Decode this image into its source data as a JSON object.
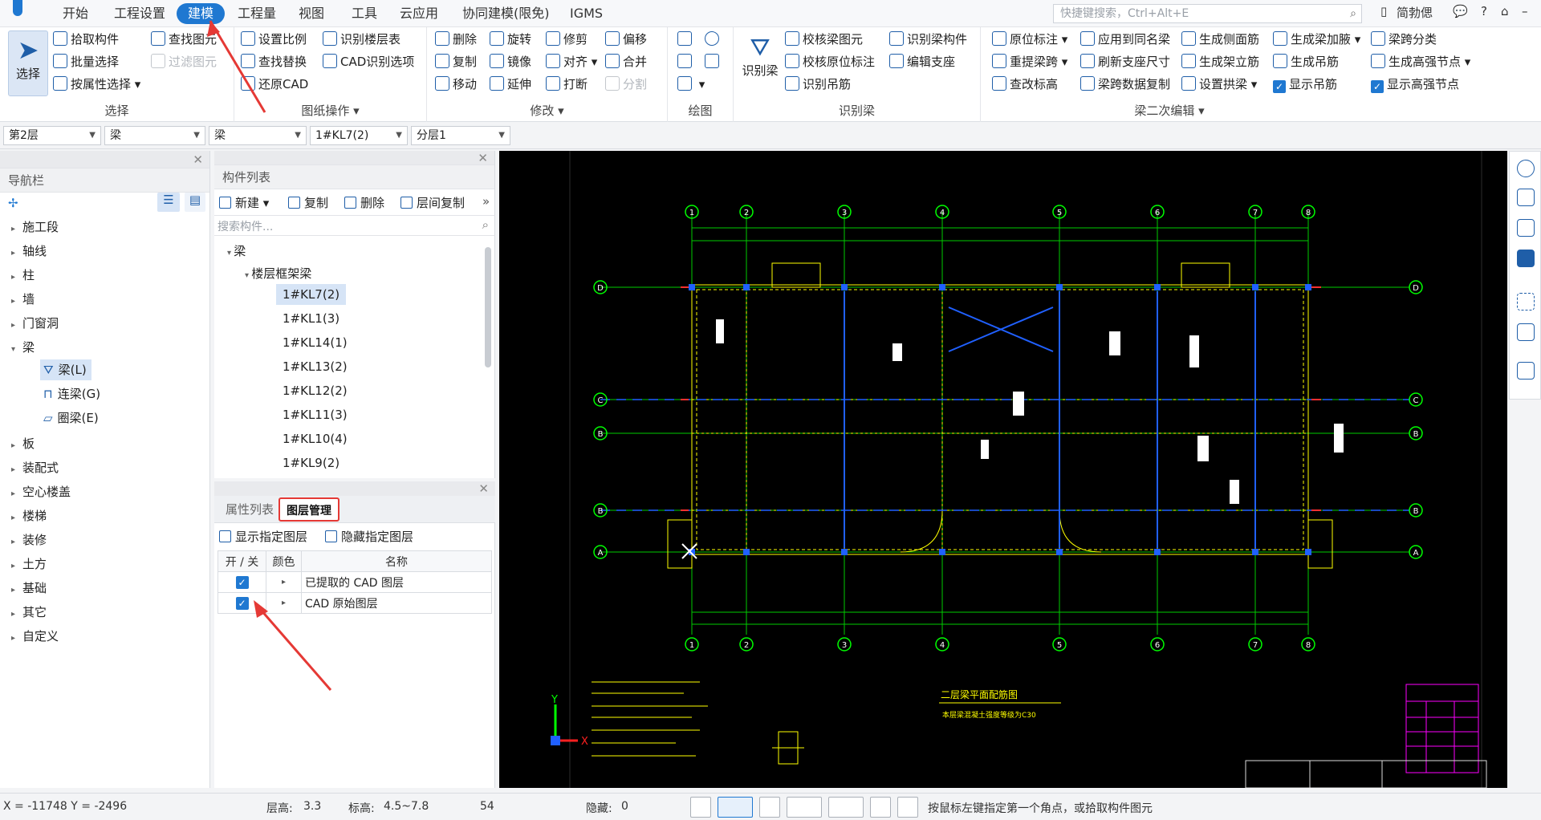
{
  "menubar": {
    "items": [
      "开始",
      "工程设置",
      "建模",
      "工程量",
      "视图",
      "工具",
      "云应用",
      "协同建模(限免)",
      "IGMS"
    ],
    "active_index": 2,
    "search_placeholder": "快捷键搜索，Ctrl+Alt+E",
    "right": {
      "user": "简勃偲",
      "help": "?",
      "chat_icon": "chat-icon",
      "share_icon": "shirt-icon"
    }
  },
  "ribbon": {
    "select_group": {
      "big_button": "选择",
      "items": [
        "拾取构件",
        "批量选择",
        "按属性选择",
        "查找图元",
        "过滤图元"
      ],
      "label": "选择"
    },
    "drawing_ops": {
      "items": [
        "设置比例",
        "识别楼层表",
        "查找替换",
        "CAD识别选项",
        "还原CAD"
      ],
      "label": "图纸操作"
    },
    "modify": {
      "items": [
        "删除",
        "旋转",
        "修剪",
        "偏移",
        "复制",
        "镜像",
        "对齐",
        "合并",
        "移动",
        "延伸",
        "打断",
        "分割"
      ],
      "label": "修改"
    },
    "draw": {
      "label": "绘图"
    },
    "recognize_beam": {
      "big_button": "识别梁",
      "items": [
        "校核梁图元",
        "识别梁构件",
        "校核原位标注",
        "编辑支座",
        "识别吊筋"
      ],
      "label": "识别梁"
    },
    "secondary_edit": {
      "items": [
        "原位标注",
        "应用到同名梁",
        "生成侧面筋",
        "生成梁加腋",
        "梁跨分类",
        "重提梁跨",
        "刷新支座尺寸",
        "生成架立筋",
        "生成吊筋",
        "生成高强节点",
        "查改标高",
        "梁跨数据复制",
        "设置拱梁",
        "显示吊筋",
        "显示高强节点"
      ],
      "label": "梁二次编辑"
    }
  },
  "selectors": [
    "第2层",
    "梁",
    "梁",
    "1#KL7(2)",
    "分层1"
  ],
  "nav": {
    "title": "导航栏",
    "tree": [
      "施工段",
      "轴线",
      "柱",
      "墙",
      "门窗洞",
      "梁",
      "板",
      "装配式",
      "空心楼盖",
      "楼梯",
      "装修",
      "土方",
      "基础",
      "其它",
      "自定义"
    ],
    "beam_children": [
      "梁(L)",
      "连梁(G)",
      "圈梁(E)"
    ]
  },
  "component_list": {
    "title": "构件列表",
    "toolbar": [
      "新建",
      "复制",
      "删除",
      "层间复制"
    ],
    "search_placeholder": "搜索构件...",
    "root": "梁",
    "category": "楼层框架梁",
    "items": [
      "1#KL7(2)",
      "1#KL1(3)",
      "1#KL14(1)",
      "1#KL13(2)",
      "1#KL12(2)",
      "1#KL11(3)",
      "1#KL10(4)",
      "1#KL9(2)"
    ],
    "selected_index": 0
  },
  "layer_panel": {
    "tabs": [
      "属性列表",
      "图层管理"
    ],
    "active_tab": 1,
    "actions": [
      "显示指定图层",
      "隐藏指定图层"
    ],
    "columns": [
      "开 / 关",
      "颜色",
      "名称"
    ],
    "rows": [
      {
        "on": true,
        "name": "已提取的 CAD 图层"
      },
      {
        "on": true,
        "name": "CAD 原始图层"
      }
    ]
  },
  "canvas": {
    "axis_labels_top": [
      "1",
      "2",
      "3",
      "4",
      "5",
      "6",
      "7",
      "8"
    ],
    "axis_labels_side": [
      "D",
      "C",
      "B",
      "B",
      "A"
    ],
    "title_block_caption": "二层梁平面配筋图",
    "title_block_sub": "本层梁混凝土强度等级为C30",
    "axis_x": "X",
    "axis_y": "Y"
  },
  "statusbar": {
    "coords": "X = -11748 Y = -2496",
    "floor_height_label": "层高:",
    "floor_height": "3.3",
    "elevation_label": "标高:",
    "elevation": "4.5~7.8",
    "count": "54",
    "hidden_label": "隐藏:",
    "hidden": "0",
    "hint": "按鼠标左键指定第一个角点，或拾取构件图元"
  },
  "colors": {
    "accent": "#1f78d1",
    "highlight": "#e53935",
    "cad_bg": "#000000",
    "grid_green": "#00ff00",
    "cad_yellow": "#ffff00",
    "cad_blue": "#2060ff",
    "cad_magenta": "#ff00ff"
  }
}
